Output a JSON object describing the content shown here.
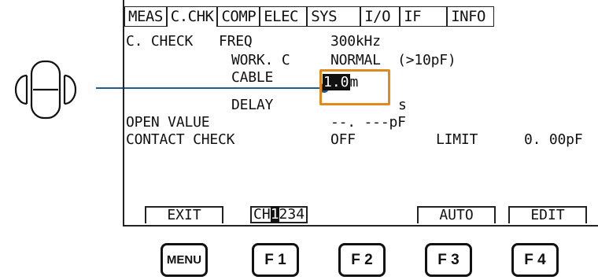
{
  "tabs": [
    {
      "label": "MEAS",
      "active": false
    },
    {
      "label": "C.CHK",
      "active": true
    },
    {
      "label": "COMP",
      "active": false
    },
    {
      "label": "ELEC",
      "active": false
    },
    {
      "label": "SYS",
      "active": false
    },
    {
      "label": "I/O",
      "active": false
    },
    {
      "label": "IF",
      "active": false
    },
    {
      "label": "INFO",
      "active": false
    }
  ],
  "settings": {
    "section_label": "C. CHECK",
    "freq_label": "FREQ",
    "freq_value": "300kHz",
    "workc_label": "WORK. C",
    "workc_value": "NORMAL  (>10pF)",
    "cable_label": "CABLE",
    "cable_value_selected": "1.0",
    "cable_unit": "m",
    "delay_label": "DELAY",
    "delay_value_partial": "s",
    "open_label": "OPEN VALUE",
    "open_value": "--. ---pF",
    "contact_label": "CONTACT CHECK",
    "contact_value": "OFF",
    "limit_label": "LIMIT",
    "limit_value": "0. 00pF"
  },
  "softkeys": {
    "exit": "EXIT",
    "channel_prefix": "CH",
    "channel_selected": "1",
    "channel_rest": "234",
    "auto": "AUTO",
    "edit": "EDIT"
  },
  "hardware_keys": {
    "menu": "MENU",
    "f1": "F 1",
    "f2": "F 2",
    "f3": "F 3",
    "f4": "F 4"
  },
  "colors": {
    "highlight_box": "#e08a1e",
    "pointer_line": "#1f5a96"
  },
  "icons": {
    "rotary_knob": "rotary-knob-icon"
  }
}
